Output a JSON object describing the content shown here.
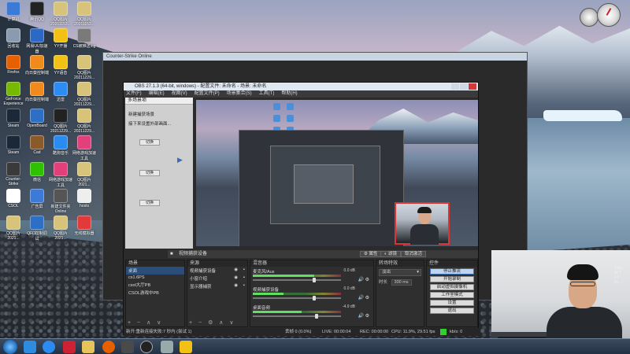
{
  "desktop": {
    "icons": [
      {
        "label": "计算机",
        "color": "#3b7ad6"
      },
      {
        "label": "腾讯QQ",
        "color": "#222222"
      },
      {
        "label": "QQ图片20211153...",
        "color": "#d8c37a"
      },
      {
        "label": "QQ图片20211153...",
        "color": "#d8c37a"
      },
      {
        "label": "回收站",
        "color": "#8a9bb0"
      },
      {
        "label": "网易UU加速器",
        "color": "#2d68c4"
      },
      {
        "label": "YY开播",
        "color": "#f2c114"
      },
      {
        "label": "CS被推送ing",
        "color": "#7a7a7a"
      },
      {
        "label": "Firefox",
        "color": "#e66000"
      },
      {
        "label": "向日葵控制端",
        "color": "#f08a1c"
      },
      {
        "label": "YY语音",
        "color": "#f2c114"
      },
      {
        "label": "QQ图片20211229...",
        "color": "#d8c37a"
      },
      {
        "label": "GeForce Experience",
        "color": "#76b900"
      },
      {
        "label": "向日葵控制端",
        "color": "#f08a1c"
      },
      {
        "label": "迅雷",
        "color": "#2c8cf4"
      },
      {
        "label": "QQ图片20211229...",
        "color": "#d8c37a"
      },
      {
        "label": "Steam",
        "color": "#1b2838"
      },
      {
        "label": "OpenBoard",
        "color": "#2d6fc4"
      },
      {
        "label": "QQ图片20211229...",
        "color": "#222222"
      },
      {
        "label": "QQ图片20211229...",
        "color": "#d8c37a"
      },
      {
        "label": "Steam",
        "color": "#1b2838"
      },
      {
        "label": "Cad",
        "color": "#8b5a2b"
      },
      {
        "label": "酷狗音乐",
        "color": "#2a8cf0"
      },
      {
        "label": "网络游戏加速工具",
        "color": "#e2407a"
      },
      {
        "label": "Counter-Strike",
        "color": "#3a3a3a"
      },
      {
        "label": "微信",
        "color": "#2dc100"
      },
      {
        "label": "网络游戏加速工具",
        "color": "#e2407a"
      },
      {
        "label": "QQ图片2021...",
        "color": "#d8c37a"
      },
      {
        "label": "CSOL",
        "color": "#ffffff"
      },
      {
        "label": "广告屏",
        "color": "#3b7ad6"
      },
      {
        "label": "新建文件夹Online",
        "color": "#555555"
      },
      {
        "label": "hosts",
        "color": "#eeeeee"
      },
      {
        "label": "QQ图片2021...",
        "color": "#d8c37a"
      },
      {
        "label": "QFD控制调试",
        "color": "#2d6fc4"
      },
      {
        "label": "QQ图片2021...",
        "color": "#d8c37a"
      },
      {
        "label": "无线模拟器",
        "color": "#e23a3a"
      }
    ]
  },
  "cs_window": {
    "title": "Counter-Strike Online"
  },
  "obs": {
    "title": "OBS 27.1.3 (64-bit, windows) - 配置文件: 未命名 - 场景: 未命名",
    "menu": [
      "文件(F)",
      "编辑(E)",
      "视图(V)",
      "配置文件(P)",
      "场景集合(S)",
      "工具(T)",
      "帮助(H)"
    ],
    "scene_panel": {
      "header": "多场景项",
      "items": [
        "新建捕获场景",
        "接下来设置外部画面..."
      ],
      "buttons": [
        "切换",
        "切换",
        "切换"
      ]
    },
    "source_bar": {
      "label": "视频捕获设备",
      "properties": "属性",
      "filters": "滤镜",
      "deactivate": "取消激活"
    },
    "scenes_dock": {
      "header": "场景",
      "items": [
        "桌面",
        "cs1.6PS",
        "csol大厅PB",
        "CSOL游戏中PB"
      ],
      "selected": 0,
      "footer": "+ − ∧ ∨"
    },
    "sources_dock": {
      "header": "来源",
      "items": [
        "视频捕获设备",
        "小窗介绍",
        "显示器捕获"
      ],
      "footer": "+ − ⚙ ∧ ∨"
    },
    "mixer_dock": {
      "header": "混音器",
      "tracks": [
        {
          "name": "麦克风/Aux",
          "db": "0.0 dB",
          "level": 0.7,
          "fader": 0.7
        },
        {
          "name": "视频捕获设备",
          "db": "0.0 dB",
          "level": 0.35,
          "fader": 0.7
        },
        {
          "name": "桌面音频",
          "db": "-4.9 dB",
          "level": 0.55,
          "fader": 0.72
        }
      ]
    },
    "transitions_dock": {
      "header": "转场特效",
      "type": "淡出",
      "duration_label": "时长",
      "duration_value": "300 ms"
    },
    "controls_dock": {
      "header": "控件",
      "buttons": [
        {
          "label": "停止推流",
          "active": true
        },
        {
          "label": "开始录制",
          "active": false
        },
        {
          "label": "启动虚拟摄像机",
          "active": false
        },
        {
          "label": "工作室模式",
          "active": false
        },
        {
          "label": "设置",
          "active": false
        },
        {
          "label": "退出",
          "active": false
        }
      ]
    },
    "status": {
      "left": "新开:重新连接失败:7 秒内 (尝试 1)",
      "dropped": "丢帧 0 (0.0%)",
      "live": "LIVE: 00:00:04",
      "rec": "REC: 00:00:00",
      "cpu": "CPU: 11.9%, 29.51 fps",
      "kbps": "kb/s: 0"
    }
  },
  "webcam_side": [
    "4 fps",
    "40 f",
    "4 f",
    "tot"
  ]
}
